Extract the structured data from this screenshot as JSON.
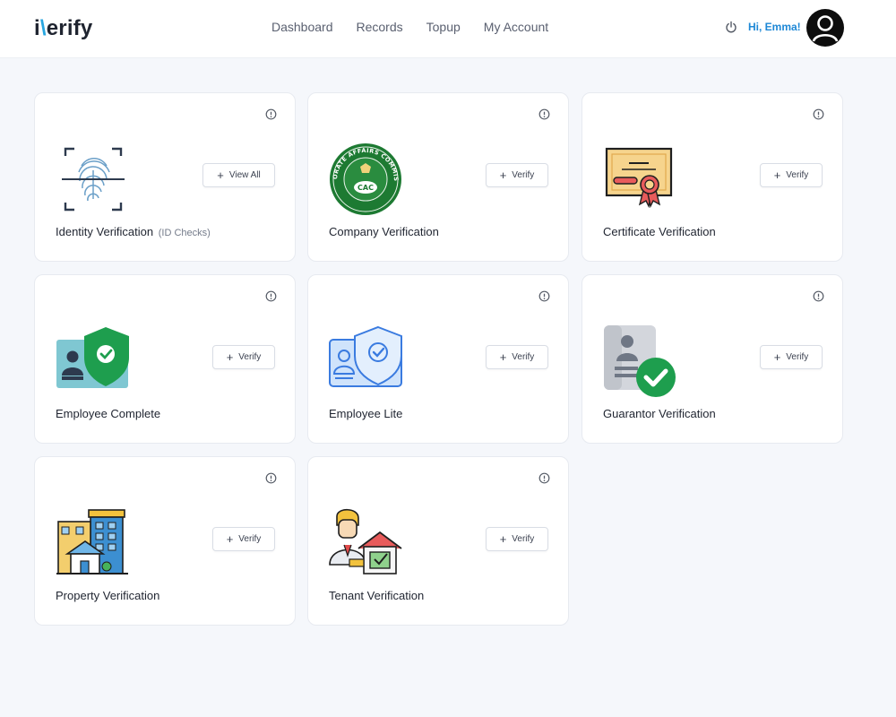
{
  "header": {
    "logo": {
      "i": "i",
      "rest": "erify"
    },
    "nav": [
      "Dashboard",
      "Records",
      "Topup",
      "My Account"
    ],
    "greeting": "Hi, Emma!"
  },
  "cards": [
    {
      "title": "Identity Verification",
      "subtitle": "(ID Checks)",
      "button": "View All",
      "icon": "fingerprint-scan-icon"
    },
    {
      "title": "Company Verification",
      "button": "Verify",
      "icon": "cac-seal-icon",
      "seal_top": "CORPORATE AFFAIRS COMMISSION",
      "seal_center": "CAC"
    },
    {
      "title": "Certificate Verification",
      "button": "Verify",
      "icon": "certificate-icon"
    },
    {
      "title": "Employee Complete",
      "button": "Verify",
      "icon": "employee-shield-check-icon"
    },
    {
      "title": "Employee Lite",
      "button": "Verify",
      "icon": "employee-shield-outline-icon"
    },
    {
      "title": "Guarantor Verification",
      "button": "Verify",
      "icon": "guarantor-check-icon"
    },
    {
      "title": "Property Verification",
      "button": "Verify",
      "icon": "buildings-icon"
    },
    {
      "title": "Tenant Verification",
      "button": "Verify",
      "icon": "tenant-house-icon"
    }
  ],
  "colors": {
    "accent_blue": "#1e88d6",
    "check_green": "#1e9e4e",
    "page_bg": "#f5f7fb"
  }
}
